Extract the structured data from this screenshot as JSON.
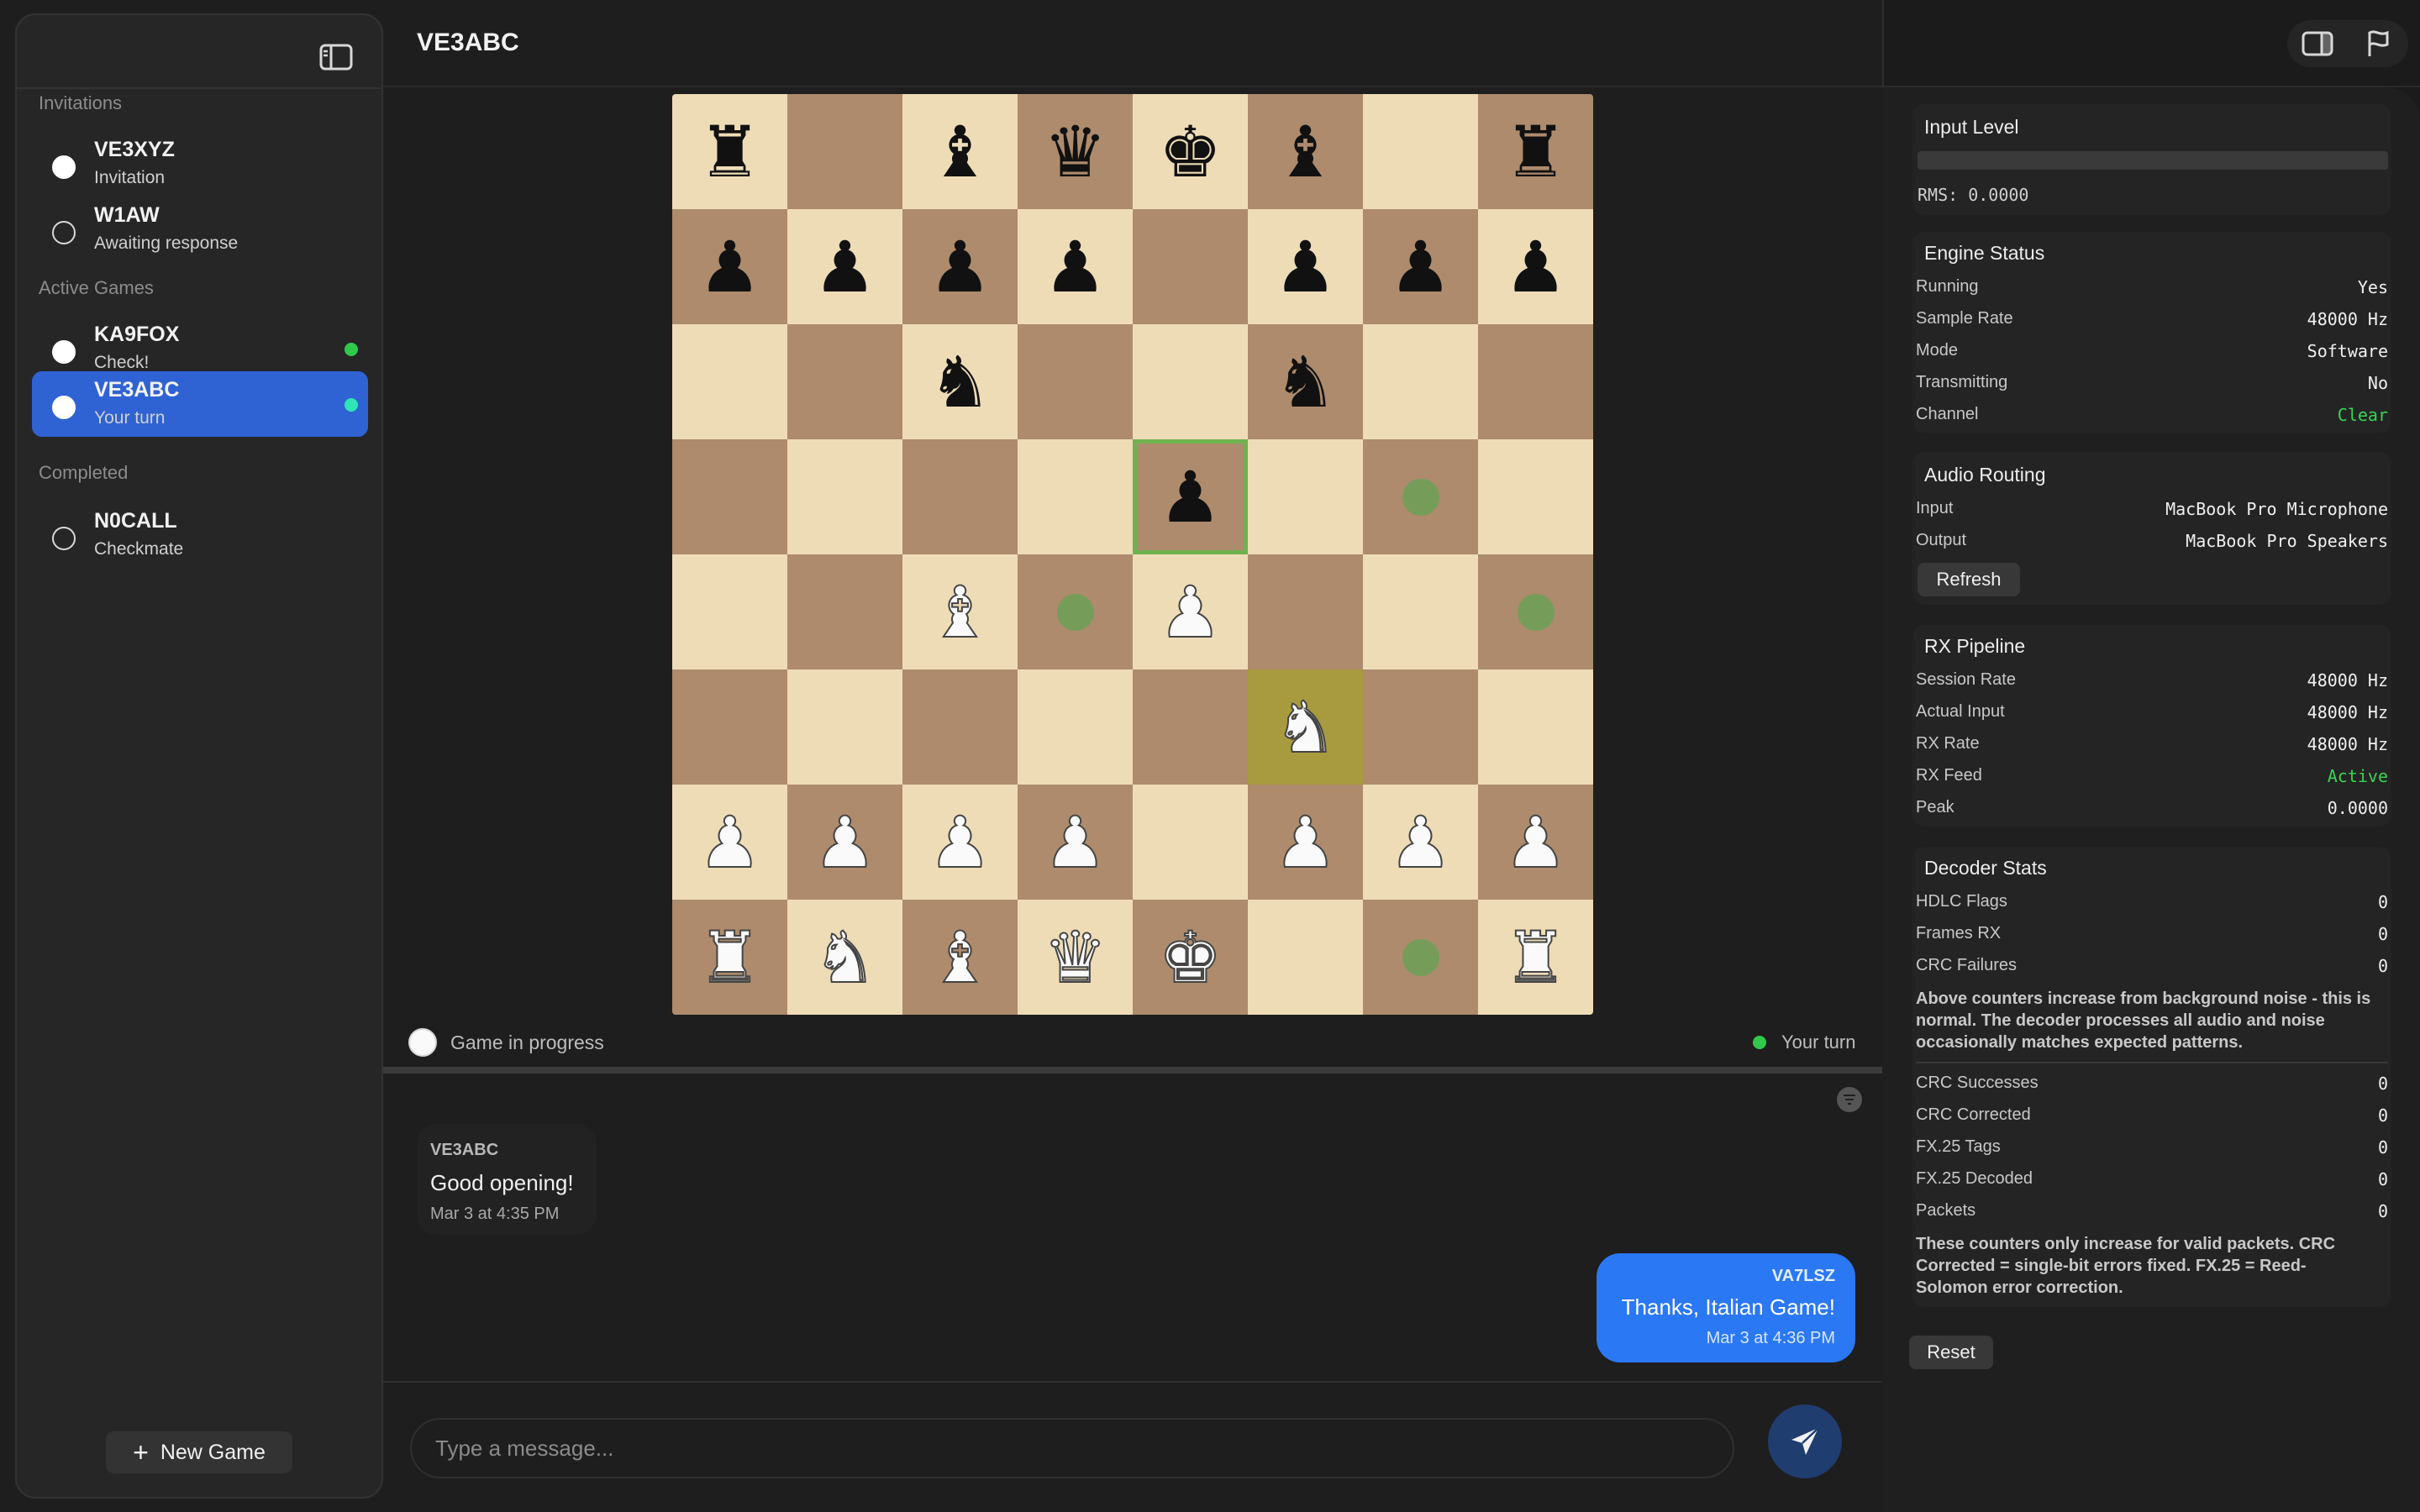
{
  "sidebar": {
    "sections": {
      "invitations": "Invitations",
      "active": "Active Games",
      "completed": "Completed"
    },
    "invitations": [
      {
        "call": "VE3XYZ",
        "sub": "Invitation"
      },
      {
        "call": "W1AW",
        "sub": "Awaiting response"
      }
    ],
    "active": [
      {
        "call": "KA9FOX",
        "sub": "Check!"
      },
      {
        "call": "VE3ABC",
        "sub": "Your turn"
      }
    ],
    "completed": [
      {
        "call": "N0CALL",
        "sub": "Checkmate"
      }
    ],
    "new_game_label": "New Game"
  },
  "main": {
    "title": "VE3ABC",
    "status": "Game in progress",
    "turn": "Your turn"
  },
  "board": {
    "ranks": [
      "r.bqkb.r",
      "pppp.ppp",
      "..n..n..",
      "....p...",
      "..B.P...",
      ".....N..",
      "PPPP.PPP",
      "RNBQK..R"
    ],
    "selected_square": "e5",
    "last_move_square": "f3",
    "move_hints": [
      "g5",
      "d4",
      "h4",
      "g1"
    ]
  },
  "chat": {
    "messages": [
      {
        "from": "VE3ABC",
        "text": "Good opening!",
        "time": "Mar 3 at 4:35 PM",
        "direction": "in"
      },
      {
        "from": "VA7LSZ",
        "text": "Thanks, Italian Game!",
        "time": "Mar 3 at 4:36 PM",
        "direction": "out"
      }
    ],
    "input_placeholder": "Type a message..."
  },
  "inspector": {
    "input_level": {
      "title": "Input Level",
      "rms": "RMS: 0.0000",
      "level": 0
    },
    "engine_status": {
      "title": "Engine Status",
      "rows": [
        {
          "k": "Running",
          "v": "Yes"
        },
        {
          "k": "Sample Rate",
          "v": "48000 Hz"
        },
        {
          "k": "Mode",
          "v": "Software"
        },
        {
          "k": "Transmitting",
          "v": "No"
        },
        {
          "k": "Channel",
          "v": "Clear"
        }
      ]
    },
    "audio_routing": {
      "title": "Audio Routing",
      "rows": [
        {
          "k": "Input",
          "v": "MacBook Pro Microphone"
        },
        {
          "k": "Output",
          "v": "MacBook Pro Speakers"
        }
      ],
      "refresh_label": "Refresh"
    },
    "rx_pipeline": {
      "title": "RX Pipeline",
      "rows": [
        {
          "k": "Session Rate",
          "v": "48000 Hz"
        },
        {
          "k": "Actual Input",
          "v": "48000 Hz"
        },
        {
          "k": "RX Rate",
          "v": "48000 Hz"
        },
        {
          "k": "RX Feed",
          "v": "Active"
        },
        {
          "k": "Peak",
          "v": "0.0000"
        }
      ]
    },
    "decoder_stats": {
      "title": "Decoder Stats",
      "rows_a": [
        {
          "k": "HDLC Flags",
          "v": "0"
        },
        {
          "k": "Frames RX",
          "v": "0"
        },
        {
          "k": "CRC Failures",
          "v": "0"
        }
      ],
      "note_a": "Above counters increase from background noise - this is normal. The decoder processes all audio and noise occasionally matches expected patterns.",
      "rows_b": [
        {
          "k": "CRC Successes",
          "v": "0"
        },
        {
          "k": "CRC Corrected",
          "v": "0"
        },
        {
          "k": "FX.25 Tags",
          "v": "0"
        },
        {
          "k": "FX.25 Decoded",
          "v": "0"
        },
        {
          "k": "Packets",
          "v": "0"
        }
      ],
      "note_b": "These counters only increase for valid packets. CRC Corrected = single-bit errors fixed. FX.25 = Reed-Solomon error correction."
    },
    "reset_label": "Reset"
  },
  "colors": {
    "accent": "#2f63d4",
    "bubble_out": "#2a78f3",
    "status_green": "#39d353",
    "board_light": "#eedcb7",
    "board_dark": "#ad8b6c",
    "last_move": "#a89b3f"
  },
  "icons": [
    "sidebar-toggle-icon",
    "inspector-toggle-icon",
    "flag-icon",
    "filter-icon",
    "plus-icon",
    "send-icon"
  ]
}
